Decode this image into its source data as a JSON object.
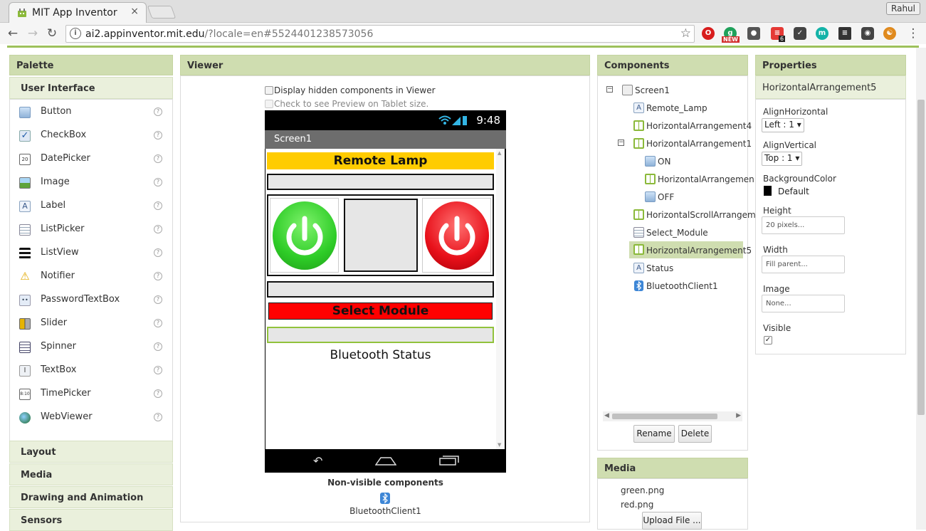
{
  "browser": {
    "tab_title": "MIT App Inventor",
    "tab_close": "×",
    "url_host": "ai2.appinventor.mit.edu",
    "url_rest": "/?locale=en#5524401238573056",
    "profile_name": "Rahul",
    "ext_badge_new": "NEW",
    "ext_badge_count": "6"
  },
  "palette": {
    "header": "Palette",
    "section": "User Interface",
    "items": [
      {
        "label": "Button",
        "icon": "button-icon"
      },
      {
        "label": "CheckBox",
        "icon": "checkbox-icon"
      },
      {
        "label": "DatePicker",
        "icon": "datepicker-icon"
      },
      {
        "label": "Image",
        "icon": "image-icon"
      },
      {
        "label": "Label",
        "icon": "label-icon"
      },
      {
        "label": "ListPicker",
        "icon": "listpicker-icon"
      },
      {
        "label": "ListView",
        "icon": "listview-icon"
      },
      {
        "label": "Notifier",
        "icon": "notifier-icon"
      },
      {
        "label": "PasswordTextBox",
        "icon": "passwordtextbox-icon"
      },
      {
        "label": "Slider",
        "icon": "slider-icon"
      },
      {
        "label": "Spinner",
        "icon": "spinner-icon"
      },
      {
        "label": "TextBox",
        "icon": "textbox-icon"
      },
      {
        "label": "TimePicker",
        "icon": "timepicker-icon"
      },
      {
        "label": "WebViewer",
        "icon": "webviewer-icon"
      }
    ],
    "help_glyph": "?",
    "categories": [
      "Layout",
      "Media",
      "Drawing and Animation",
      "Sensors"
    ]
  },
  "viewer": {
    "header": "Viewer",
    "display_hidden_label": "Display hidden components in Viewer",
    "tablet_preview_label": "Check to see Preview on Tablet size.",
    "status_time": "9:48",
    "screen_title": "Screen1",
    "remote_lamp_text": "Remote Lamp",
    "select_module_text": "Select Module",
    "bluetooth_status_text": "Bluetooth Status",
    "nonvisible_title": "Non-visible components",
    "nonvisible_items": [
      "BluetoothClient1"
    ]
  },
  "components": {
    "header": "Components",
    "tree": [
      {
        "label": "Screen1",
        "icon": "screen-icon"
      },
      {
        "label": "Remote_Lamp",
        "icon": "label-icon"
      },
      {
        "label": "HorizontalArrangement4",
        "icon": "arrangement-icon"
      },
      {
        "label": "HorizontalArrangement1",
        "icon": "arrangement-icon"
      },
      {
        "label": "ON",
        "icon": "button-icon"
      },
      {
        "label": "HorizontalArrangemen",
        "icon": "arrangement-icon"
      },
      {
        "label": "OFF",
        "icon": "button-icon"
      },
      {
        "label": "HorizontalScrollArrangem",
        "icon": "arrangement-icon"
      },
      {
        "label": "Select_Module",
        "icon": "listpicker-icon"
      },
      {
        "label": "HorizontalArrangement5",
        "icon": "arrangement-icon",
        "selected": true
      },
      {
        "label": "Status",
        "icon": "label-icon"
      },
      {
        "label": "BluetoothClient1",
        "icon": "bluetooth-icon"
      }
    ],
    "rename_label": "Rename",
    "delete_label": "Delete"
  },
  "media": {
    "header": "Media",
    "files": [
      "green.png",
      "red.png"
    ],
    "upload_label": "Upload File ..."
  },
  "properties": {
    "header": "Properties",
    "component_name": "HorizontalArrangement5",
    "align_horizontal_label": "AlignHorizontal",
    "align_horizontal_value": "Left : 1 ▾",
    "align_vertical_label": "AlignVertical",
    "align_vertical_value": "Top : 1 ▾",
    "background_color_label": "BackgroundColor",
    "background_color_value": "Default",
    "height_label": "Height",
    "height_value": "20 pixels...",
    "width_label": "Width",
    "width_value": "Fill parent...",
    "image_label": "Image",
    "image_value": "None...",
    "visible_label": "Visible",
    "visible_checked": true
  },
  "colors": {
    "header_green": "#cfddb0",
    "accent_green": "#9dc15b",
    "lamp_yellow": "#ffcc00",
    "select_red": "#ff0000",
    "on_green": "#2ecc27",
    "off_red": "#e8101a"
  }
}
